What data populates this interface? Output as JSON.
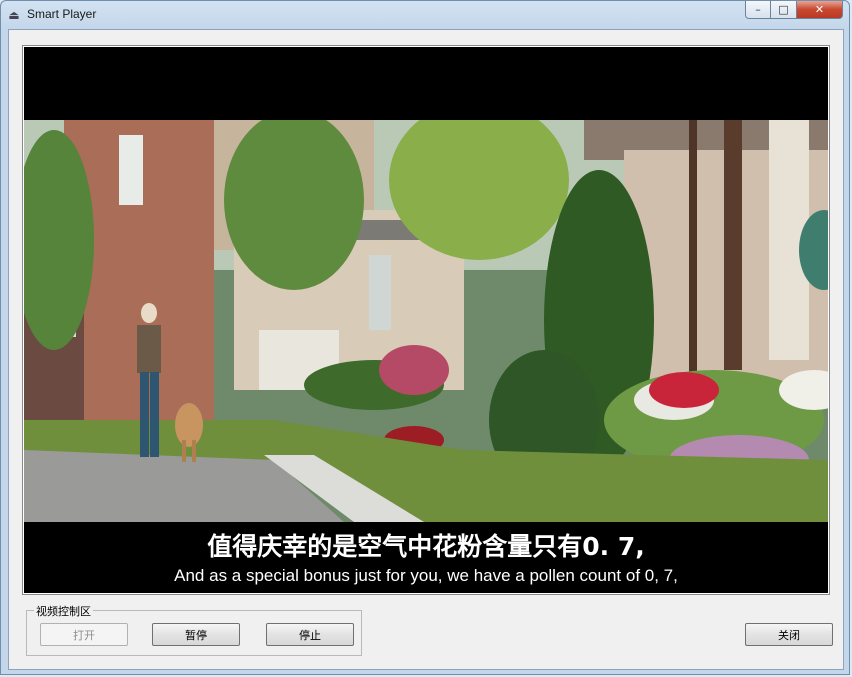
{
  "window": {
    "title": "Smart Player",
    "app_icon": "player-icon",
    "controls": {
      "minimize": "minimize-icon",
      "maximize": "maximize-icon",
      "close": "close-icon"
    }
  },
  "video": {
    "subtitle_zh": "值得庆幸的是空气中花粉含量只有0. 7,",
    "subtitle_en": "And as a special bonus just for you, we have a pollen count of 0, 7,"
  },
  "controls_group": {
    "label": "视频控制区",
    "buttons": [
      {
        "label": "打开",
        "enabled": false
      },
      {
        "label": "暂停",
        "enabled": true
      },
      {
        "label": "停止",
        "enabled": true
      }
    ]
  },
  "close_button": {
    "label": "关闭"
  },
  "colors": {
    "title_bar": "#c3d6ea",
    "client_bg": "#f0f0f0",
    "video_bg": "#000000"
  }
}
